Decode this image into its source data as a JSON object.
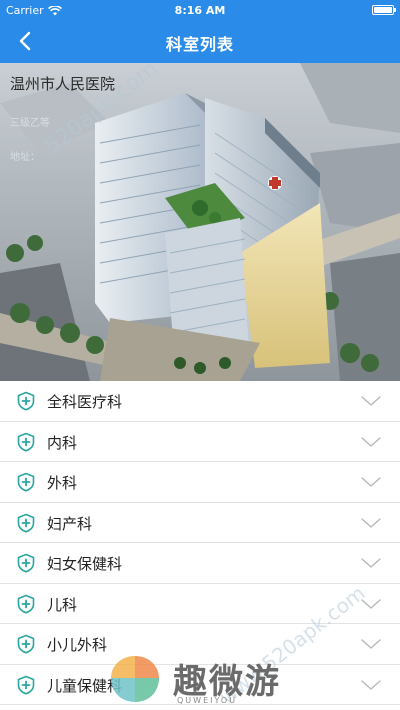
{
  "status_bar": {
    "carrier": "Carrier",
    "time": "8:16 AM"
  },
  "navbar": {
    "title": "科室列表"
  },
  "hospital": {
    "name": "温州市人民医院",
    "level": "三级乙等",
    "address": "地址："
  },
  "departments": [
    {
      "label": "全科医疗科"
    },
    {
      "label": "内科"
    },
    {
      "label": "外科"
    },
    {
      "label": "妇产科"
    },
    {
      "label": "妇女保健科"
    },
    {
      "label": "儿科"
    },
    {
      "label": "小儿外科"
    },
    {
      "label": "儿童保健科"
    }
  ],
  "watermarks": {
    "site_top": "520apk.com",
    "site_mid": "www.520apk.com",
    "brand": "趣微游",
    "brand_sub": "QUWEIYOU"
  },
  "colors": {
    "accent": "#2a8be8",
    "icon": "#2aa6a0"
  }
}
